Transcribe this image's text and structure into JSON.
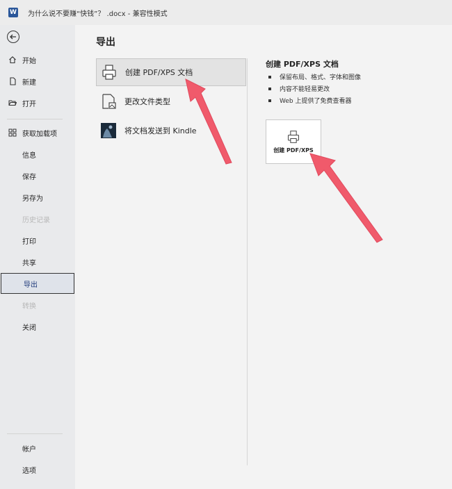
{
  "titlebar": {
    "app_logo": "W",
    "title": "为什么说不要赚“快钱”？ .docx  -  兼容性模式"
  },
  "sidebar": {
    "back_icon": "arrow-left-circle-icon",
    "top_items": [
      {
        "label": "开始",
        "icon": "home-icon"
      },
      {
        "label": "新建",
        "icon": "new-document-icon"
      },
      {
        "label": "打开",
        "icon": "folder-open-icon"
      }
    ],
    "addins_label": "获取加载项",
    "items": [
      {
        "label": "信息"
      },
      {
        "label": "保存"
      },
      {
        "label": "另存为"
      },
      {
        "label": "历史记录"
      },
      {
        "label": "打印"
      },
      {
        "label": "共享"
      },
      {
        "label": "导出"
      },
      {
        "label": "转换"
      },
      {
        "label": "关闭"
      }
    ],
    "bottom_items": [
      {
        "label": "帐户"
      },
      {
        "label": "选项"
      }
    ]
  },
  "main": {
    "heading": "导出",
    "options": [
      {
        "label": "创建 PDF/XPS 文档",
        "icon": "pdf-printer-icon"
      },
      {
        "label": "更改文件类型",
        "icon": "change-file-type-icon"
      },
      {
        "label": "将文档发送到 Kindle",
        "icon": "kindle-icon"
      }
    ],
    "detail": {
      "title": "创建 PDF/XPS 文档",
      "bullets": [
        "保留布局、格式、字体和图像",
        "内容不能轻易更改",
        "Web 上提供了免费查看器"
      ],
      "button_label": "创建 PDF/XPS"
    }
  },
  "colors": {
    "annotation_arrow": "#f05a6b",
    "active_nav_text": "#1f3a7a",
    "word_blue": "#2b579a"
  }
}
